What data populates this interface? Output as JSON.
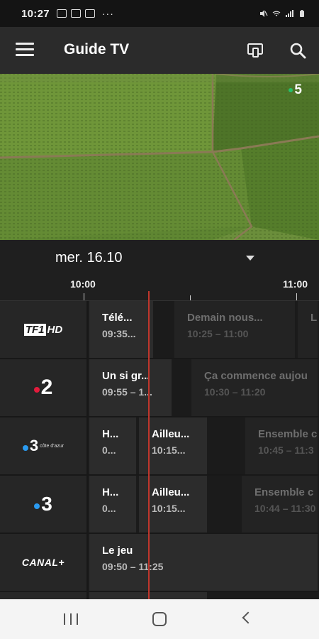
{
  "status_bar": {
    "time": "10:27",
    "dots": "···"
  },
  "app_bar": {
    "title": "Guide TV"
  },
  "video": {
    "channel_overlay": "5"
  },
  "date_selector": {
    "label": "mer. 16.10"
  },
  "timeline": {
    "ticks": [
      "10:00",
      "11:00"
    ]
  },
  "channels": [
    {
      "name": "TF1 HD",
      "logo_text": "TF1",
      "logo_suffix": "HD",
      "programs": [
        {
          "title": "Télé...",
          "time": "09:35...",
          "state": "now"
        },
        {
          "title": "Demain nous...",
          "time": "10:25 – 11:00",
          "state": "future"
        },
        {
          "title": "L",
          "time": "",
          "state": "future"
        }
      ]
    },
    {
      "name": "France 2",
      "logo_text": "2",
      "programs": [
        {
          "title": "Un si gr...",
          "time": "09:55 – 1...",
          "state": "now"
        },
        {
          "title": "Ça commence aujou",
          "time": "10:30 – 11:20",
          "state": "future"
        }
      ]
    },
    {
      "name": "France 3 Côte d'Azur",
      "logo_text": "3",
      "logo_suffix": "côte d'azur",
      "programs": [
        {
          "title": "H...",
          "time": "0...",
          "state": "now"
        },
        {
          "title": "Ailleu...",
          "time": "10:15...",
          "state": "now"
        },
        {
          "title": "Ensemble c",
          "time": "10:45 – 11:3",
          "state": "future"
        }
      ]
    },
    {
      "name": "France 3",
      "logo_text": "3",
      "programs": [
        {
          "title": "H...",
          "time": "0...",
          "state": "now"
        },
        {
          "title": "Ailleu...",
          "time": "10:15...",
          "state": "now"
        },
        {
          "title": "Ensemble c",
          "time": "10:44 – 11:30",
          "state": "future"
        }
      ]
    },
    {
      "name": "Canal+",
      "logo_text": "CANAL+",
      "programs": [
        {
          "title": "Le jeu",
          "time": "09:50 – 11:25",
          "state": "now"
        }
      ]
    }
  ],
  "colors": {
    "now_line": "#c0362c",
    "france2_dot": "#e21b3c",
    "france3_dot": "#2a9af0",
    "france5_dot": "#26c06b"
  },
  "icons": [
    "menu-icon",
    "cast-icon",
    "search-icon",
    "dropdown-icon",
    "nav-recents-icon",
    "nav-home-icon",
    "nav-back-icon"
  ]
}
